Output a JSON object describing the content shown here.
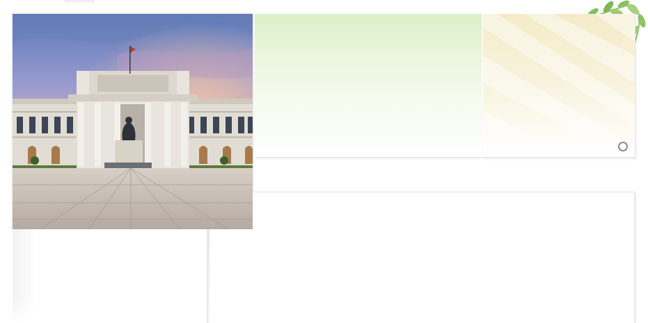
{
  "banner": {
    "photo": {
      "icon": "museum-building-photo",
      "colors": {
        "sky_top": "#5f7fbf",
        "sky_mid": "#b79ac3",
        "sky_glow": "#f0b9a6",
        "building": "#e6e2da",
        "pavement": "#cfc6bd"
      }
    },
    "carousel": {
      "indicator_icon": "radio-circle-icon",
      "active_index": 0
    },
    "panels": {
      "green_color": "#dcefc8",
      "cream_color": "#f4ecc8"
    }
  },
  "decoration": {
    "icon": "leaf-branch-icon",
    "color": "#8fc46a"
  }
}
